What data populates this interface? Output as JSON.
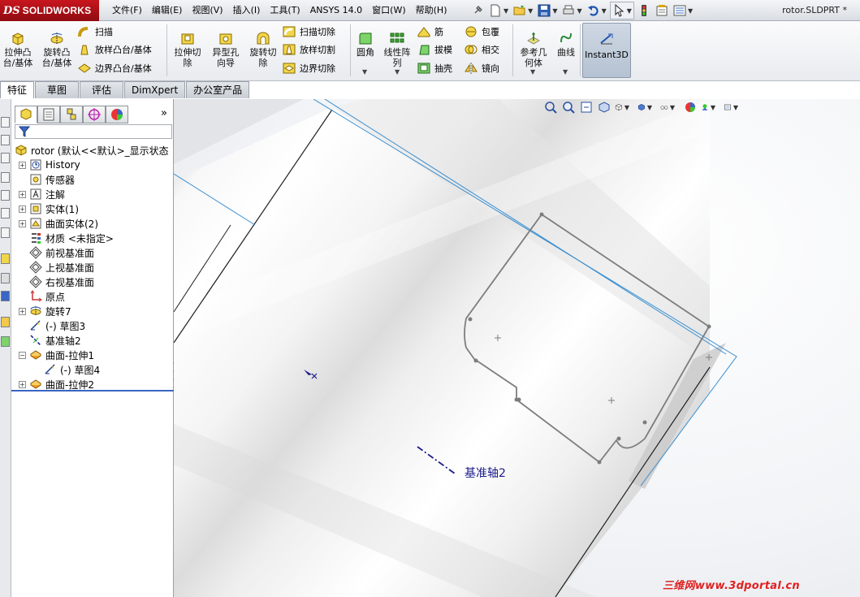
{
  "app": {
    "logo_prefix": "DS",
    "logo_text": "SOLIDWORKS",
    "document_title": "rotor.SLDPRT *"
  },
  "menu": {
    "items": [
      "文件(F)",
      "编辑(E)",
      "视图(V)",
      "插入(I)",
      "工具(T)",
      "ANSYS 14.0",
      "窗口(W)",
      "帮助(H)"
    ]
  },
  "command_manager": {
    "extrude_boss": "拉伸凸\n台/基体",
    "revolve_boss": "旋转凸\n台/基体",
    "sweep": "扫描",
    "loft": "放样凸台/基体",
    "boundary": "边界凸台/基体",
    "extrude_cut": "拉伸切\n除",
    "hole_wizard": "异型孔\n向导",
    "revolve_cut": "旋转切\n除",
    "sweep_cut": "扫描切除",
    "loft_cut": "放样切割",
    "boundary_cut": "边界切除",
    "fillet": "圆角",
    "linear_pattern": "线性阵\n列",
    "rib": "筋",
    "draft": "拔模",
    "shell": "抽壳",
    "wrap": "包覆",
    "intersect": "相交",
    "mirror": "镜向",
    "ref_geometry": "参考几\n何体",
    "curves": "曲线",
    "instant3d": "Instant3D"
  },
  "tabs": [
    "特征",
    "草图",
    "评估",
    "DimXpert",
    "办公室产品"
  ],
  "active_tab": 0,
  "feature_tree": {
    "root": "rotor  (默认<<默认>_显示状态",
    "nodes": [
      {
        "label": "History",
        "icon": "history-icon",
        "expandable": true
      },
      {
        "label": "传感器",
        "icon": "sensor-icon",
        "expandable": false
      },
      {
        "label": "注解",
        "icon": "annotation-icon",
        "expandable": true
      },
      {
        "label": "实体(1)",
        "icon": "solid-body-icon",
        "expandable": true
      },
      {
        "label": "曲面实体(2)",
        "icon": "surface-body-icon",
        "expandable": true
      },
      {
        "label": "材质 <未指定>",
        "icon": "material-icon",
        "expandable": false
      },
      {
        "label": "前视基准面",
        "icon": "plane-icon",
        "expandable": false
      },
      {
        "label": "上视基准面",
        "icon": "plane-icon",
        "expandable": false
      },
      {
        "label": "右视基准面",
        "icon": "plane-icon",
        "expandable": false
      },
      {
        "label": "原点",
        "icon": "origin-icon",
        "expandable": false
      },
      {
        "label": "旋转7",
        "icon": "revolve-icon",
        "expandable": true
      },
      {
        "label": "(-) 草图3",
        "icon": "sketch-icon",
        "expandable": false
      },
      {
        "label": "基准轴2",
        "icon": "axis-icon",
        "expandable": false
      },
      {
        "label": "曲面-拉伸1",
        "icon": "surface-extrude-icon",
        "expandable": true,
        "expanded": true
      },
      {
        "label": "(-) 草图4",
        "icon": "sketch-icon",
        "expandable": false,
        "child": true
      },
      {
        "label": "曲面-拉伸2",
        "icon": "surface-extrude-icon",
        "expandable": true
      }
    ]
  },
  "viewport": {
    "axis_label": "基准轴2",
    "watermark": "三维网www.3dportal.cn"
  },
  "colors": {
    "logo_red": "#b01218",
    "sketch_line": "#7d7d7d",
    "axis_blue": "#1a1a8a",
    "edge_blue": "#3a8fd0",
    "watermark_red": "#e02020"
  }
}
